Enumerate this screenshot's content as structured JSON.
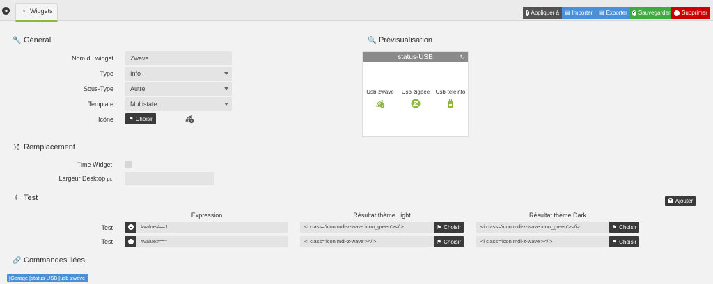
{
  "tab": {
    "label": "Widgets",
    "icon": "dashboard-icon"
  },
  "actions": [
    {
      "label": "Appliquer à",
      "icon": "plus-circle-icon"
    },
    {
      "label": "Importer",
      "icon": "file-import-icon"
    },
    {
      "label": "Exporter",
      "icon": "file-export-icon"
    },
    {
      "label": "Sauvegarder",
      "icon": "check-circle-icon"
    },
    {
      "label": "Supprimer",
      "icon": "minus-circle-icon"
    }
  ],
  "general": {
    "title": "Général",
    "name_label": "Nom du widget",
    "name_value": "Zwave",
    "type_label": "Type",
    "type_value": "Info",
    "subtype_label": "Sous-Type",
    "subtype_value": "Autre",
    "template_label": "Template",
    "template_value": "Multistate",
    "icon_label": "Icône",
    "choose_label": "Choisir"
  },
  "preview": {
    "title": "Prévisualisation",
    "widget_title": "status-USB",
    "items": [
      {
        "label": "Usb-zwave",
        "icon": "zwave-icon"
      },
      {
        "label": "Usb-zigbee",
        "icon": "zigbee-icon"
      },
      {
        "label": "Usb-teleinfo",
        "icon": "teleinfo-icon"
      }
    ]
  },
  "replacement": {
    "title": "Remplacement",
    "time_widget_label": "Time Widget",
    "width_label": "Largeur Desktop",
    "width_unit": "px",
    "width_value": ""
  },
  "test": {
    "title": "Test",
    "add_label": "Ajouter",
    "col_expression": "Expression",
    "col_light": "Résultat thème Light",
    "col_dark": "Résultat thème Dark",
    "choose_label": "Choisir",
    "rows": [
      {
        "label": "Test",
        "expression": "#value#==1",
        "light": "<i class='icon mdi-z-wave icon_green'></i>",
        "dark": "<i class='icon mdi-z-wave icon_green'></i>"
      },
      {
        "label": "Test",
        "expression": "#value#==''",
        "light": "<i class='icon mdi-z-wave'></i>",
        "dark": "<i class='icon mdi-z-wave'></i>"
      }
    ]
  },
  "linked": {
    "title": "Commandes liées",
    "items": [
      "[Garage][status-USB][usb-zwave]"
    ]
  },
  "colors": {
    "accent_green": "#8db83b",
    "blue": "#4a90d9",
    "success": "#3faa3f",
    "danger": "#cc0000",
    "dark": "#3a3a3a"
  }
}
